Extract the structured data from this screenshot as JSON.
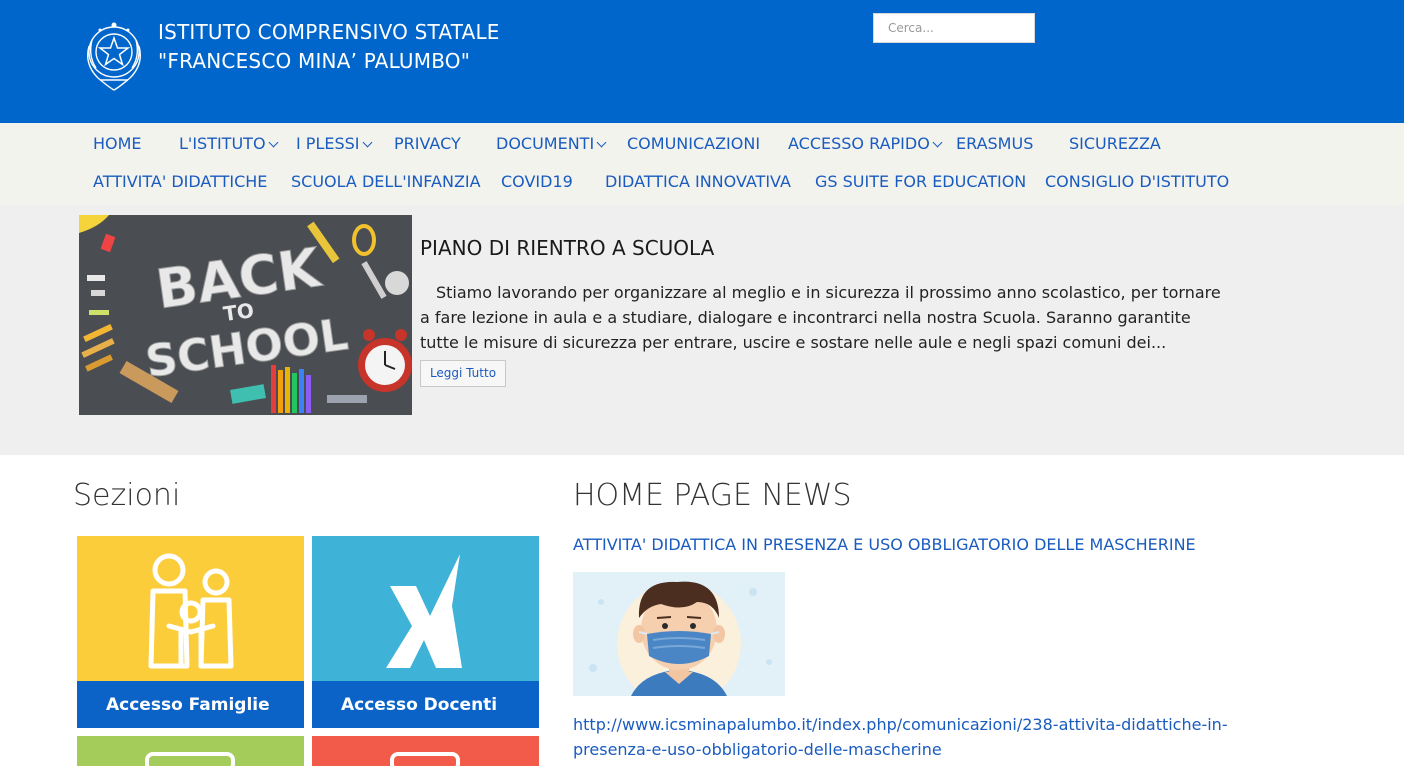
{
  "header": {
    "title_line1": "ISTITUTO COMPRENSIVO STATALE",
    "title_line2": "\"FRANCESCO MINA’ PALUMBO\"",
    "search_placeholder": "Cerca..."
  },
  "nav": {
    "row1": [
      {
        "label": "HOME",
        "dropdown": false
      },
      {
        "label": "L'ISTITUTO",
        "dropdown": true
      },
      {
        "label": "I PLESSI",
        "dropdown": true
      },
      {
        "label": "PRIVACY",
        "dropdown": false
      },
      {
        "label": "DOCUMENTI",
        "dropdown": true
      },
      {
        "label": "COMUNICAZIONI",
        "dropdown": false
      },
      {
        "label": "ACCESSO RAPIDO",
        "dropdown": true
      },
      {
        "label": "ERASMUS",
        "dropdown": false
      },
      {
        "label": "SICUREZZA",
        "dropdown": false
      }
    ],
    "row2": [
      {
        "label": "ATTIVITA' DIDATTICHE"
      },
      {
        "label": "SCUOLA DELL'INFANZIA"
      },
      {
        "label": "COVID19"
      },
      {
        "label": "DIDATTICA INNOVATIVA"
      },
      {
        "label": "GS SUITE FOR EDUCATION"
      },
      {
        "label": "CONSIGLIO D'ISTITUTO"
      }
    ]
  },
  "featured": {
    "image_text_line1": "BACK",
    "image_text_line2": "TO",
    "image_text_line3": "SCHOOL",
    "title": "PIANO DI RIENTRO A SCUOLA",
    "text": "Stiamo lavorando per organizzare al meglio e in sicurezza il prossimo anno scolastico, per tornare a fare lezione in aula e a studiare, dialogare e incontrarci nella nostra Scuola. Saranno garantite tutte le misure di sicurezza per entrare, uscire e sostare nelle aule e negli spazi comuni dei...",
    "read_more": "Leggi Tutto"
  },
  "sections": {
    "title": "Sezioni",
    "tiles": [
      {
        "label": "Accesso Famiglie",
        "color": "#fccd3b"
      },
      {
        "label": "Accesso Docenti",
        "color": "#3fb2d8"
      }
    ],
    "tile_colors_row2": [
      "#a3cc5a",
      "#f25a4a"
    ]
  },
  "news": {
    "title": "HOME PAGE NEWS",
    "item_title": "ATTIVITA' DIDATTICA IN PRESENZA E USO OBBLIGATORIO DELLE MASCHERINE",
    "item_url": "http://www.icsminapalumbo.it/index.php/comunicazioni/238-attivita-didattiche-in-presenza-e-uso-obbligatorio-delle-mascherine"
  },
  "colors": {
    "header_blue": "#0066cc",
    "nav_bg": "#f3f3ee",
    "link_blue": "#1a5bbf"
  }
}
